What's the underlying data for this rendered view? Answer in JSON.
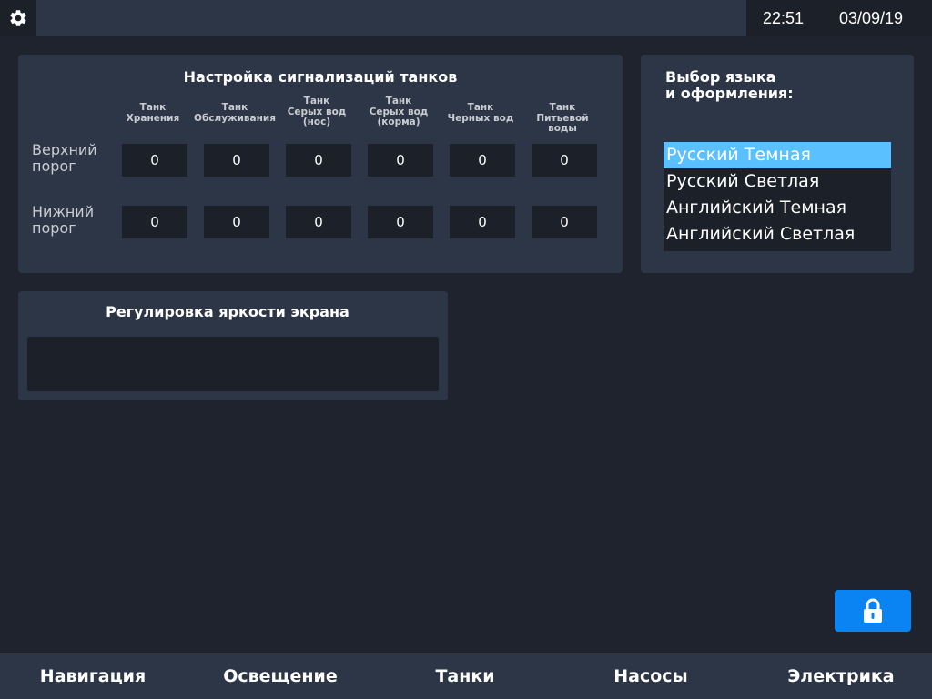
{
  "topbar": {
    "time": "22:51",
    "date": "03/09/19",
    "settings_icon": "gear-icon"
  },
  "tank_alarms": {
    "title": "Настройка сигнализаций танков",
    "columns": [
      {
        "line1": "Танк",
        "line2": "Хранения",
        "line3": ""
      },
      {
        "line1": "Танк",
        "line2": "Обслуживания",
        "line3": ""
      },
      {
        "line1": "Танк",
        "line2": "Серых вод",
        "line3": "(нос)"
      },
      {
        "line1": "Танк",
        "line2": "Серых вод",
        "line3": "(корма)"
      },
      {
        "line1": "Танк",
        "line2": "Черных вод",
        "line3": ""
      },
      {
        "line1": "Танк",
        "line2": "Питьевой",
        "line3": "воды"
      }
    ],
    "rows": [
      {
        "label_line1": "Верхний",
        "label_line2": "порог",
        "values": [
          "0",
          "0",
          "0",
          "0",
          "0",
          "0"
        ]
      },
      {
        "label_line1": "Нижний",
        "label_line2": "порог",
        "values": [
          "0",
          "0",
          "0",
          "0",
          "0",
          "0"
        ]
      }
    ]
  },
  "language": {
    "title_line1": "Выбор языка",
    "title_line2": "и оформления:",
    "options": [
      "Русский Темная",
      "Русский Светлая",
      "Английский Темная",
      "Английский Светлая"
    ],
    "selected_index": 0,
    "selected_color": "#5bc0ff"
  },
  "brightness": {
    "title": "Регулировка яркости экрана"
  },
  "lock": {
    "icon": "lock-icon",
    "color": "#0a84f3"
  },
  "bottom_nav": {
    "items": [
      "Навигация",
      "Освещение",
      "Танки",
      "Насосы",
      "Электрика"
    ]
  }
}
